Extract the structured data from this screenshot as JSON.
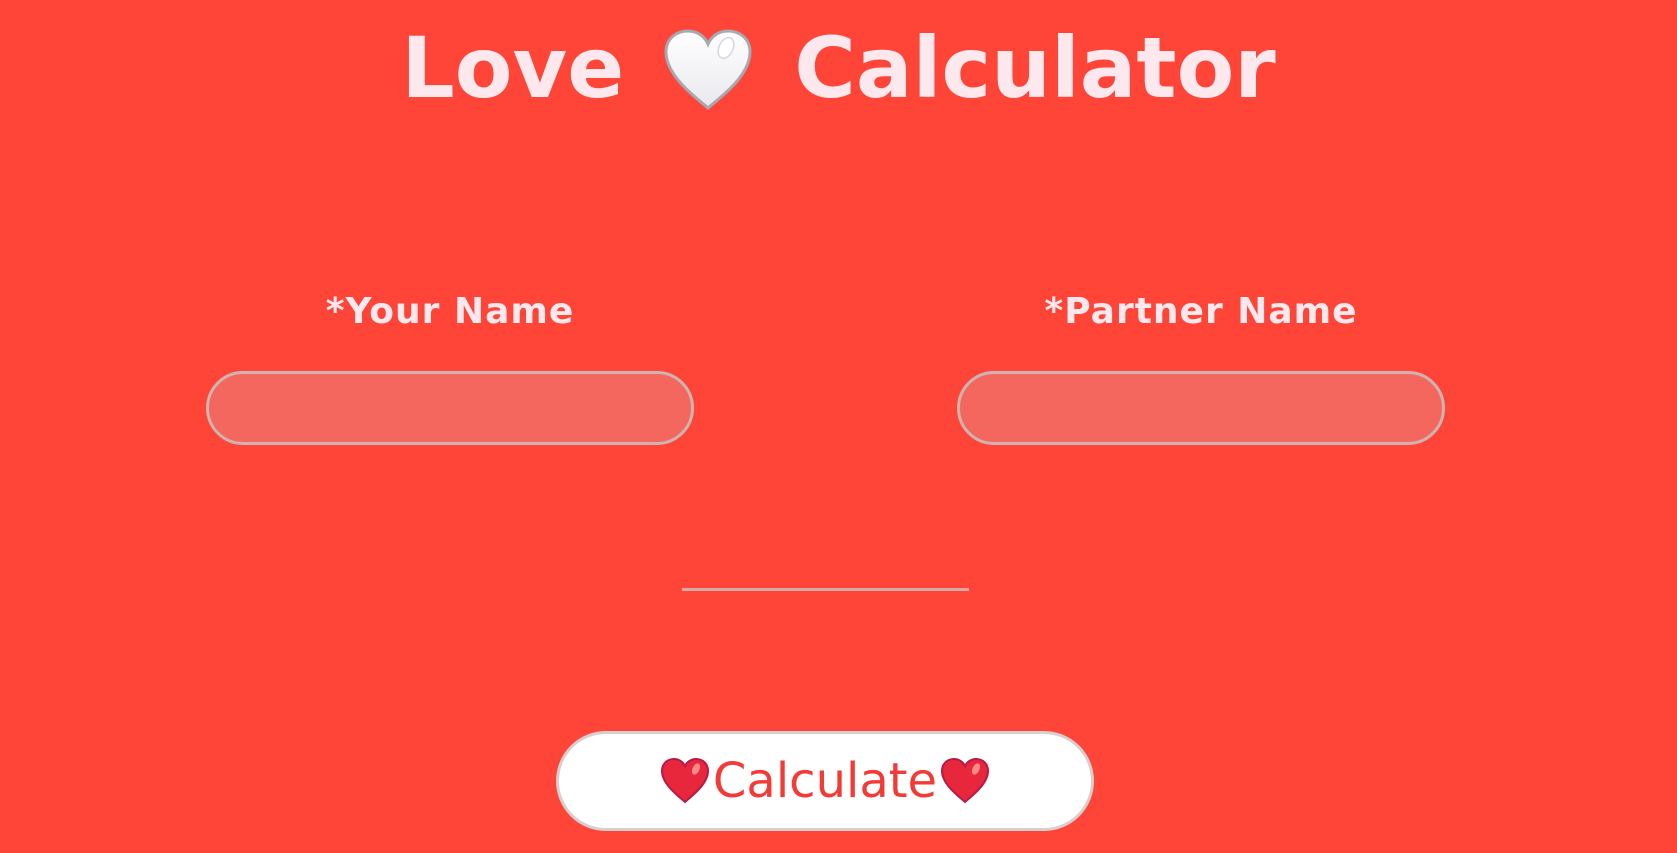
{
  "header": {
    "title_part1": "Love",
    "title_icon": "white-heart-icon",
    "title_part2": "Calculator"
  },
  "form": {
    "your_name": {
      "label": "*Your Name",
      "value": "",
      "placeholder": ""
    },
    "partner_name": {
      "label": "*Partner Name",
      "value": "",
      "placeholder": ""
    }
  },
  "result": {
    "text": ""
  },
  "calculate_button": {
    "label": "Calculate",
    "icon_left": "red-heart-icon",
    "icon_right": "red-heart-icon"
  },
  "colors": {
    "background": "#ff4438",
    "text_light": "#fde8ee",
    "button_text": "#f23a36",
    "heart_red": "#e8263c"
  }
}
